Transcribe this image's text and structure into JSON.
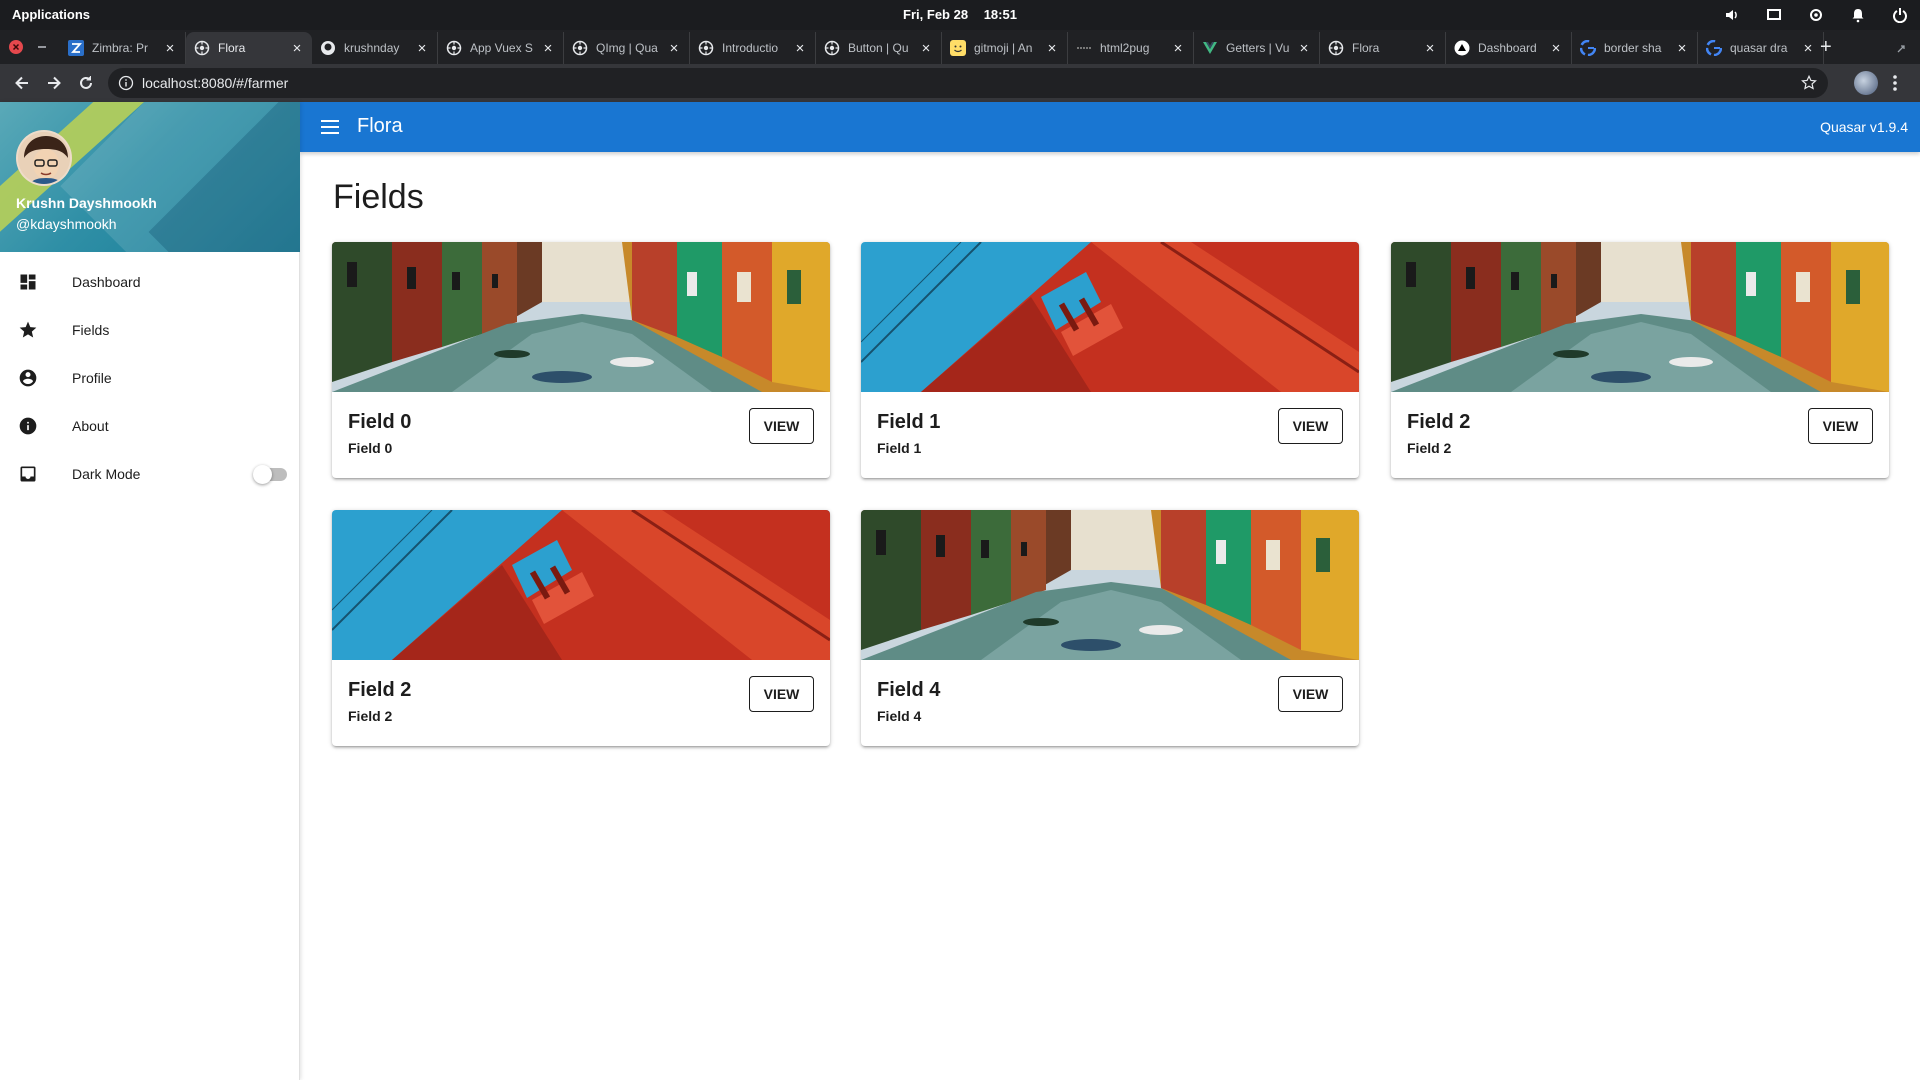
{
  "os": {
    "apps_label": "Applications",
    "date": "Fri, Feb 28",
    "time": "18:51",
    "tray_icons": [
      "volume-icon",
      "display-icon",
      "settings-icon",
      "bell-icon",
      "power-icon"
    ]
  },
  "browser": {
    "tabs": [
      {
        "title": "Zimbra: Pr",
        "icon": "zimbra-icon",
        "active": false
      },
      {
        "title": "Flora",
        "icon": "quasar-icon",
        "active": true
      },
      {
        "title": "krushnday",
        "icon": "github-icon",
        "active": false
      },
      {
        "title": "App Vuex S",
        "icon": "quasar-icon",
        "active": false
      },
      {
        "title": "QImg | Qua",
        "icon": "quasar-icon",
        "active": false
      },
      {
        "title": "Introductio",
        "icon": "quasar-icon",
        "active": false
      },
      {
        "title": "Button | Qu",
        "icon": "quasar-icon",
        "active": false
      },
      {
        "title": "gitmoji | An",
        "icon": "gitmoji-icon",
        "active": false
      },
      {
        "title": "html2pug",
        "icon": "html2pug-icon",
        "active": false
      },
      {
        "title": "Getters | Vu",
        "icon": "vue-icon",
        "active": false
      },
      {
        "title": "Flora",
        "icon": "quasar-icon",
        "active": false
      },
      {
        "title": "Dashboard",
        "icon": "vercel-icon",
        "active": false
      },
      {
        "title": "border sha",
        "icon": "google-icon",
        "active": false
      },
      {
        "title": "quasar dra",
        "icon": "google-icon",
        "active": false
      }
    ],
    "url": "localhost:8080/#/farmer"
  },
  "drawer": {
    "user_name": "Krushn Dayshmookh",
    "user_handle": "@kdayshmookh",
    "items": [
      {
        "label": "Dashboard",
        "icon": "dashboard-icon"
      },
      {
        "label": "Fields",
        "icon": "star-icon"
      },
      {
        "label": "Profile",
        "icon": "account-circle-icon"
      },
      {
        "label": "About",
        "icon": "info-icon"
      },
      {
        "label": "Dark Mode",
        "icon": "inbox-icon"
      }
    ],
    "dark_mode": false
  },
  "header": {
    "title": "Flora",
    "version": "Quasar v1.9.4",
    "color": "#1976d2"
  },
  "page": {
    "title": "Fields",
    "cards": [
      {
        "title": "Field 0",
        "subtitle": "Field 0",
        "button": "VIEW",
        "image": "canal-town-photo"
      },
      {
        "title": "Field 1",
        "subtitle": "Field 1",
        "button": "VIEW",
        "image": "red-bridge-photo"
      },
      {
        "title": "Field 2",
        "subtitle": "Field 2",
        "button": "VIEW",
        "image": "canal-town-photo"
      },
      {
        "title": "Field 2",
        "subtitle": "Field 2",
        "button": "VIEW",
        "image": "red-bridge-photo"
      },
      {
        "title": "Field 4",
        "subtitle": "Field 4",
        "button": "VIEW",
        "image": "canal-town-photo"
      }
    ]
  }
}
